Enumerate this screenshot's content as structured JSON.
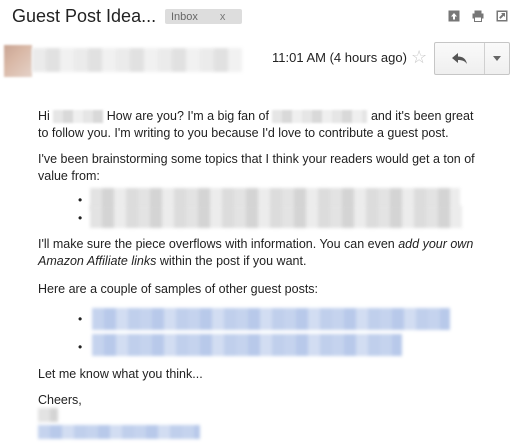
{
  "header": {
    "subject": "Guest Post Idea...",
    "label": "Inbox",
    "label_close": "x",
    "icons": [
      "archive-icon",
      "print-icon",
      "new-window-icon"
    ]
  },
  "message": {
    "timestamp": "11:01 AM (4 hours ago)",
    "star_glyph": "☆",
    "reply_icon": "reply-arrow-icon",
    "more_icon": "dropdown-caret-icon"
  },
  "body": {
    "greeting_start": "Hi",
    "greeting_mid": "How are you? I'm a big fan of",
    "greeting_end": "and it's been great",
    "line2": "to follow you. I'm writing to you because I'd love to contribute a guest post.",
    "brainstorm_l1": "I've been brainstorming some topics that I think your readers would get a ton of",
    "brainstorm_l2": "value from:",
    "overflow_l1": "I'll make sure the piece overflows with information. You can even",
    "overflow_em1": "add your own",
    "overflow_em2": "Amazon Affiliate links",
    "overflow_l2_end": "within the post if you want.",
    "samples": "Here are a couple of samples of other guest posts:",
    "closing": "Let me know what you think...",
    "signoff": "Cheers,",
    "bullet": "•"
  },
  "colors": {
    "link_blur": "#c5d3ee",
    "text_blur": "#e3e3e3",
    "star": "#c8c8c8"
  }
}
